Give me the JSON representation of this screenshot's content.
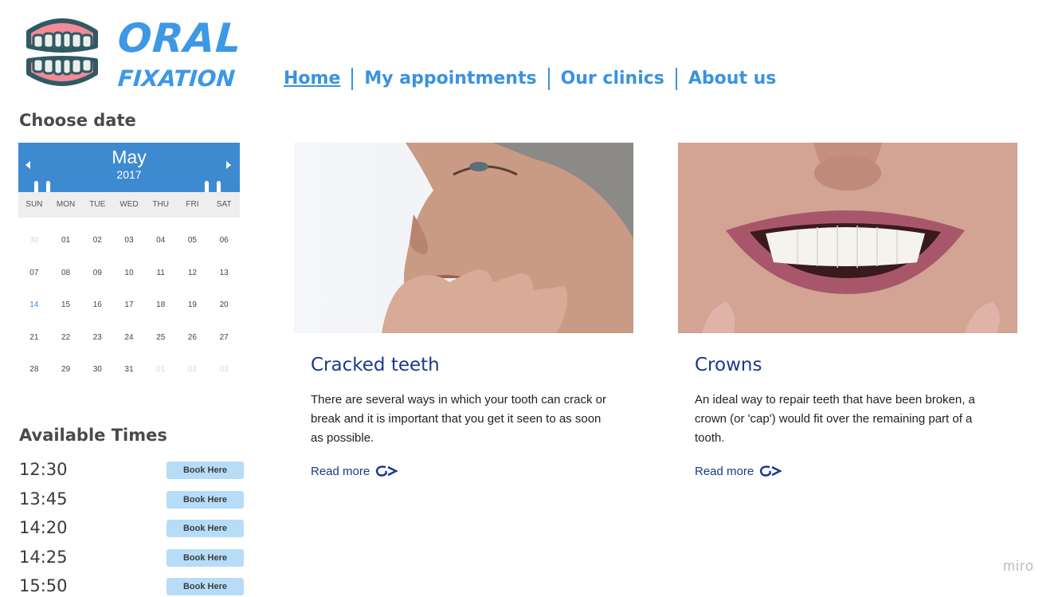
{
  "brand": {
    "line1": "ORAL",
    "line2": "FIXATION"
  },
  "nav": [
    {
      "label": "Home",
      "active": true
    },
    {
      "label": "My appointments",
      "active": false
    },
    {
      "label": "Our clinics",
      "active": false
    },
    {
      "label": "About us",
      "active": false
    }
  ],
  "date_picker": {
    "title": "Choose date",
    "month": "May",
    "year": "2017",
    "days_of_week": [
      "SUN",
      "MON",
      "TUE",
      "WED",
      "THU",
      "FRI",
      "SAT"
    ],
    "weeks": [
      [
        "30",
        "01",
        "02",
        "03",
        "04",
        "05",
        "06"
      ],
      [
        "07",
        "08",
        "09",
        "10",
        "11",
        "12",
        "13"
      ],
      [
        "14",
        "15",
        "16",
        "17",
        "18",
        "19",
        "20"
      ],
      [
        "21",
        "22",
        "23",
        "24",
        "25",
        "26",
        "27"
      ],
      [
        "28",
        "29",
        "30",
        "31",
        "01",
        "02",
        "03"
      ]
    ],
    "highlighted_day": "14",
    "accent_color": "#3e8ad1"
  },
  "times": {
    "title": "Available Times",
    "button_label": "Book Here",
    "slots": [
      "12:30",
      "13:45",
      "14:20",
      "14:25",
      "15:50"
    ]
  },
  "cards": [
    {
      "title": "Cracked teeth",
      "text": "There are several ways in which your tooth can crack or break and it is important that you get it seen to as soon as possible.",
      "link": "Read more"
    },
    {
      "title": "Crowns",
      "text": "An ideal way to repair teeth that have been broken, a crown (or 'cap') would fit over the remaining part of a tooth.",
      "link": "Read more"
    }
  ],
  "watermark": "miro",
  "colors": {
    "brand_blue": "#3d98e6",
    "title_navy": "#193a8a",
    "button_bg": "#b6dcf8"
  }
}
